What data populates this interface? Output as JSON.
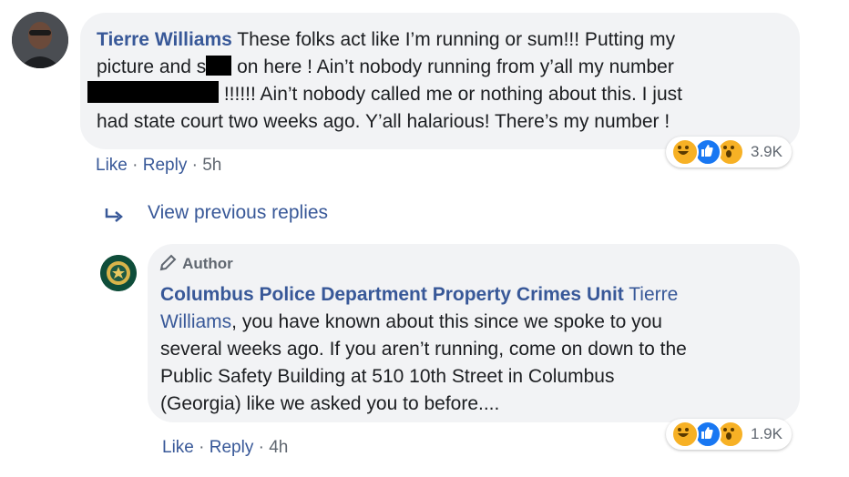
{
  "comment1": {
    "author": "Tierre Williams",
    "line1_text": "These folks act like I’m running or sum!!! Putting my",
    "line2_pre": "picture and s",
    "line2_post": " on here ! Ain’t nobody running from y’all my number",
    "line3_post": "!!!!!! Ain’t nobody called me or nothing about this. I just",
    "line4": "had state court two weeks ago. Y’all halarious! There’s my number !",
    "like": "Like",
    "reply": "Reply",
    "sep": "·",
    "time": "5h",
    "reaction_count": "3.9K"
  },
  "view_previous": "View previous replies",
  "comment2": {
    "badge": "Author",
    "author": "Columbus Police Department Property Crimes Unit",
    "mention": "Tierre",
    "line2_mention": "Williams",
    "line2_text": ", you have known about this since we spoke to you",
    "line3": "several weeks ago. If you aren’t running, come on down to the",
    "line4": "Public Safety Building at 510 10th Street in Columbus",
    "line5": "(Georgia) like we asked you to before....",
    "like": "Like",
    "reply": "Reply",
    "sep": "·",
    "time": "4h",
    "reaction_count": "1.9K"
  },
  "colors": {
    "link": "#385898",
    "bubble": "#f2f3f5",
    "meta": "#606770"
  },
  "icons": [
    "haha-icon",
    "like-icon",
    "wow-icon",
    "reply-arrow-icon",
    "pencil-icon",
    "police-badge-icon"
  ]
}
